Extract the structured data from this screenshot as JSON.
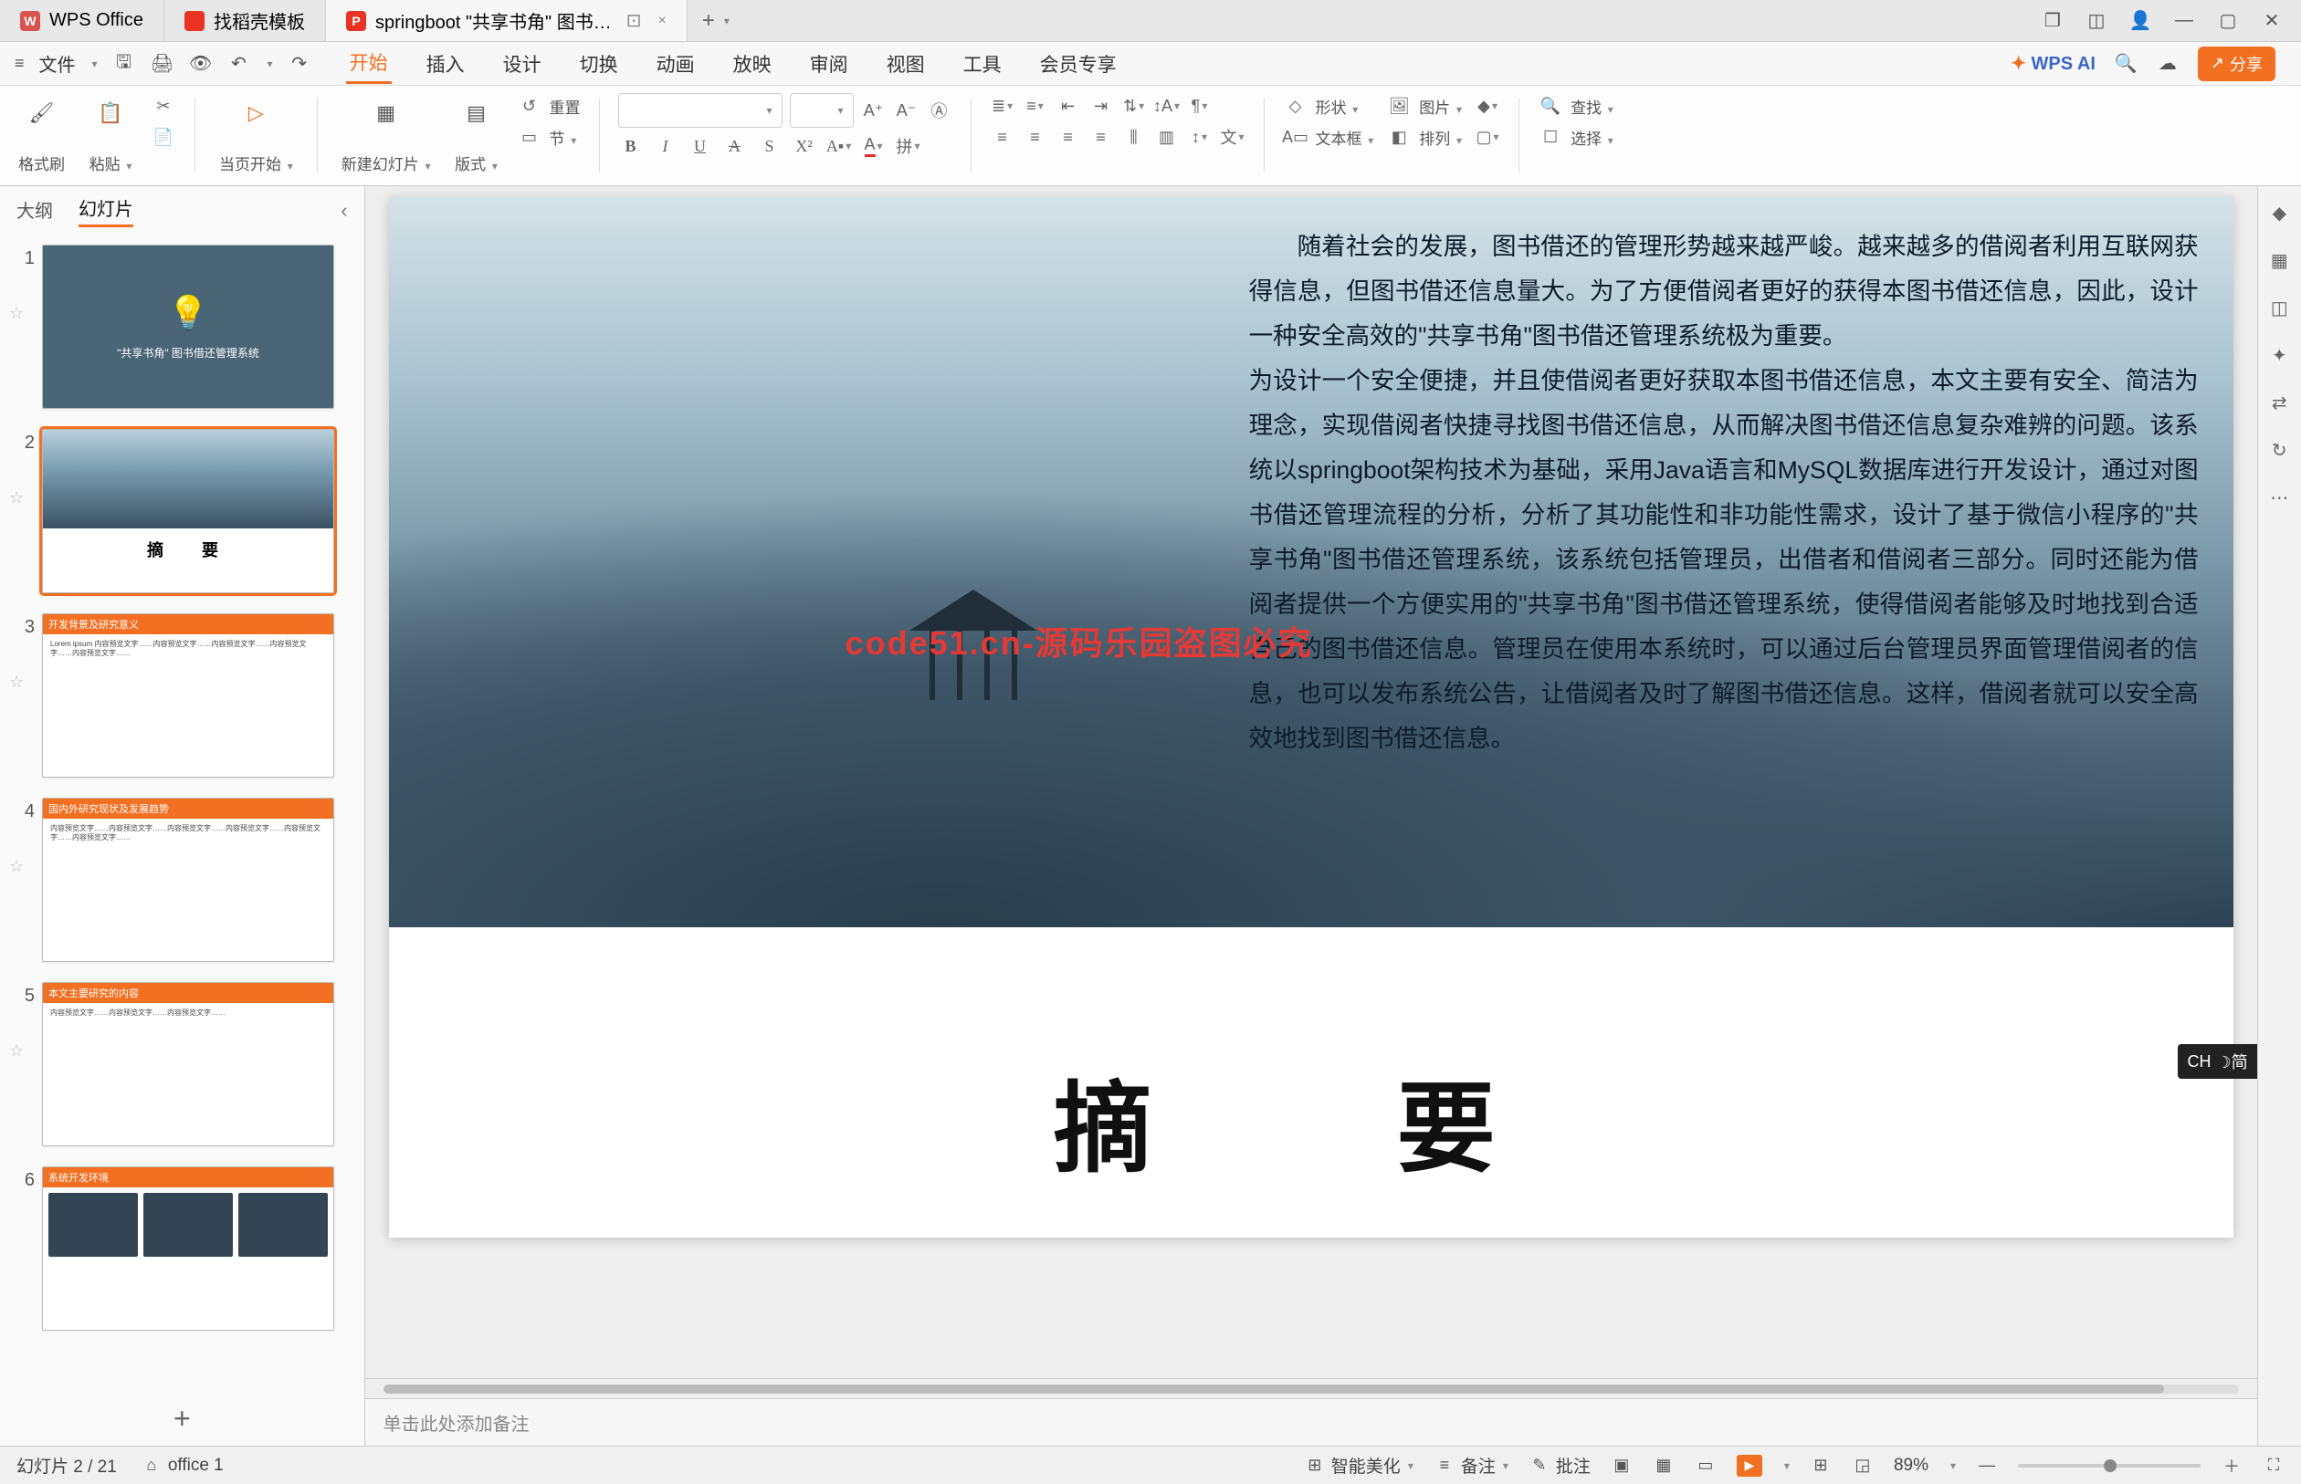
{
  "titlebar": {
    "tabs": [
      {
        "icon": "W",
        "label": "WPS Office"
      },
      {
        "icon": "R",
        "label": "找稻壳模板"
      },
      {
        "icon": "P",
        "label": "springboot \"共享书角\" 图书…",
        "active": true
      }
    ],
    "add_tab": "+",
    "win_icons": [
      "layers-icon",
      "cube-icon",
      "avatar-icon",
      "minimize-icon",
      "maximize-icon",
      "close-icon"
    ]
  },
  "quickbar": {
    "file_menu_icon": "≡",
    "file_label": "文件",
    "icons": [
      "save-icon",
      "print-icon",
      "preview-icon",
      "undo-icon",
      "redo-icon"
    ]
  },
  "menubar": {
    "items": [
      "开始",
      "插入",
      "设计",
      "切换",
      "动画",
      "放映",
      "审阅",
      "视图",
      "工具",
      "会员专享"
    ],
    "active_index": 0,
    "ai": "WPS AI",
    "search_icon": "search-icon",
    "cloud_icon": "cloud-icon",
    "share": "分享"
  },
  "ribbon": {
    "format_painter": "格式刷",
    "paste": "粘贴",
    "from_slide": "当页开始",
    "new_slide": "新建幻灯片",
    "layout": "版式",
    "reset": "重置",
    "section": "节",
    "font_placeholder": "",
    "size_placeholder": "",
    "shape": "形状",
    "image": "图片",
    "textbox": "文本框",
    "arrange": "排列",
    "find": "查找",
    "select": "选择"
  },
  "slidepanel": {
    "tabs": [
      "大纲",
      "幻灯片"
    ],
    "active_index": 1,
    "collapse": "‹",
    "thumbs": [
      {
        "num": "1",
        "title": "\"共享书角\" 图书借还管理系统"
      },
      {
        "num": "2",
        "title": "摘　要",
        "selected": true
      },
      {
        "num": "3",
        "bar": "开发背景及研究意义"
      },
      {
        "num": "4",
        "bar": "国内外研究现状及发展趋势"
      },
      {
        "num": "5",
        "bar": "本文主要研究的内容"
      },
      {
        "num": "6",
        "bar": "系统开发环境"
      }
    ],
    "add": "+"
  },
  "slide": {
    "para1": "随着社会的发展，图书借还的管理形势越来越严峻。越来越多的借阅者利用互联网获得信息，但图书借还信息量大。为了方便借阅者更好的获得本图书借还信息，因此，设计一种安全高效的\"共享书角\"图书借还管理系统极为重要。",
    "para2": "为设计一个安全便捷，并且使借阅者更好获取本图书借还信息，本文主要有安全、简洁为理念，实现借阅者快捷寻找图书借还信息，从而解决图书借还信息复杂难辨的问题。该系统以springboot架构技术为基础，采用Java语言和MySQL数据库进行开发设计，通过对图书借还管理流程的分析，分析了其功能性和非功能性需求，设计了基于微信小程序的\"共享书角\"图书借还管理系统，该系统包括管理员，出借者和借阅者三部分。同时还能为借阅者提供一个方便实用的\"共享书角\"图书借还管理系统，使得借阅者能够及时地找到合适自己的图书借还信息。管理员在使用本系统时，可以通过后台管理员界面管理借阅者的信息，也可以发布系统公告，让借阅者及时了解图书借还信息。这样，借阅者就可以安全高效地找到图书借还信息。",
    "heading": "摘　要",
    "watermark": "code51.cn-源码乐园盗图必究"
  },
  "notes": {
    "placeholder": "单击此处添加备注"
  },
  "ime": {
    "lang": "CH",
    "mode": "☽简"
  },
  "statusbar": {
    "slide_counter": "幻灯片 2 / 21",
    "office": "office 1",
    "beautify": "智能美化",
    "notes": "备注",
    "comments": "批注",
    "zoom": "89%"
  }
}
